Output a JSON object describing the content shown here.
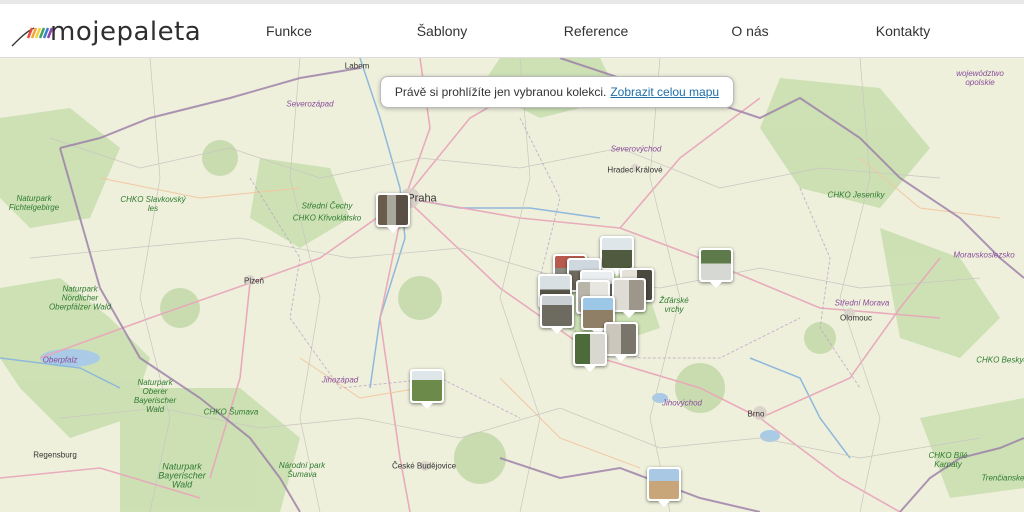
{
  "brand": {
    "name": "mojepaleta"
  },
  "nav": {
    "items": [
      {
        "label": "Funkce"
      },
      {
        "label": "Šablony"
      },
      {
        "label": "Reference"
      },
      {
        "label": "O nás"
      },
      {
        "label": "Kontakty"
      }
    ]
  },
  "banner": {
    "text": "Právě si prohlížíte jen vybranou kolekci.",
    "link": "Zobrazit celou mapu"
  },
  "map": {
    "labels": {
      "labem": "Labem",
      "severozapad": "Severozápad",
      "praha": "Praha",
      "severovychod": "Severovýchod",
      "hradec": "Hradec Králové",
      "naturpark_fichtel": "Naturpark Fichtelgebirge",
      "chko_slavkovsky": "CHKO Slavkovský les",
      "stredni_cechy": "Střední Čechy",
      "chko_krivoklatsko": "CHKO Křivoklátsko",
      "plzen": "Plzeň",
      "naturpark_nordlicher": "Naturpark Nördlicher Oberpfälzer Wald",
      "oberpfalz": "Oberpfalz",
      "naturpark_oberer": "Naturpark Oberer Bayerischer Wald",
      "chko_sumava": "CHKO Šumava",
      "jihozapad": "Jihozápad",
      "regensburg": "Regensburg",
      "naturpark_bayerischer": "Naturpark Bayerischer Wald",
      "narodni_park": "Národní park Šumava",
      "ceske_budejovice": "České Budějovice",
      "zdarske": "Žďárské vrchy",
      "jihovychod": "Jihovýchod",
      "brno": "Brno",
      "chko_jeseniky": "CHKO Jeseníky",
      "moravskoslezsko": "Moravskoslezsko",
      "stredni_morava": "Střední Morava",
      "olomouc": "Olomouc",
      "chko_beskydy": "CHKO Beskydy",
      "chko_bile_karpaty": "CHKO Bílé Karpaty",
      "trencianske": "Trenčianske",
      "wojewodztwo": "województwo opolskie"
    },
    "colors": {
      "land": "#eef0dc",
      "forest": "#c9dfb0",
      "road": "#e9a8ba",
      "border": "#9b7ca8",
      "water": "#a9cbe6"
    }
  }
}
